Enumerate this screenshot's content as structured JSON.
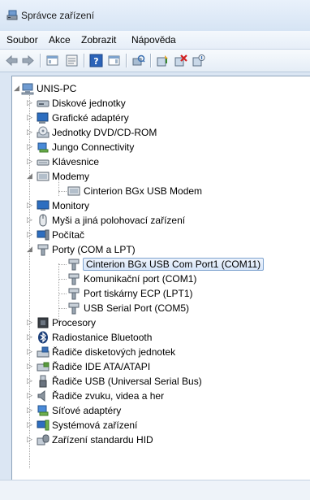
{
  "window": {
    "title": "Správce zařízení"
  },
  "menu": {
    "file": "Soubor",
    "action": "Akce",
    "view": "Zobrazit",
    "help": "Nápověda"
  },
  "tree": {
    "root": "UNIS-PC",
    "disks": "Diskové jednotky",
    "display": "Grafické adaptéry",
    "dvd": "Jednotky DVD/CD-ROM",
    "jungo": "Jungo Connectivity",
    "keyboards": "Klávesnice",
    "modems": "Modemy",
    "modem_child": "Cinterion BGx USB Modem",
    "monitors": "Monitory",
    "mice": "Myši a jiná polohovací zařízení",
    "computer": "Počítač",
    "ports": "Porty (COM a LPT)",
    "port_1": "Cinterion BGx USB Com Port1 (COM11)",
    "port_2": "Komunikační port (COM1)",
    "port_3": "Port tiskárny ECP (LPT1)",
    "port_4": "USB Serial Port (COM5)",
    "processors": "Procesory",
    "bluetooth": "Radiostanice Bluetooth",
    "floppy": "Řadiče disketových jednotek",
    "ide": "Řadiče IDE ATA/ATAPI",
    "usb": "Řadiče USB (Universal Serial Bus)",
    "sound": "Řadiče zvuku, videa a her",
    "network": "Síťové adaptéry",
    "system": "Systémová zařízení",
    "hid": "Zařízení standardu HID"
  }
}
